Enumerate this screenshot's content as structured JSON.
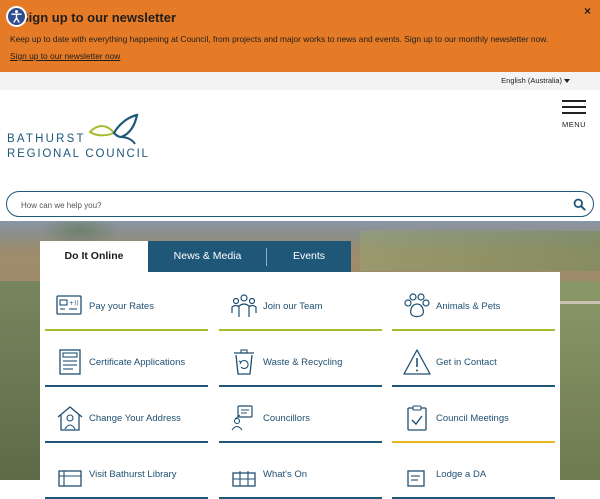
{
  "banner": {
    "title": "Sign up to our newsletter",
    "text": "Keep up to date with everything happening at Council, from projects and major works to news and events. Sign up to our monthly newsletter now.",
    "link": "Sign up to our newsletter now",
    "close": "×",
    "color": "#e57b26"
  },
  "language": {
    "selected": "English (Australia)"
  },
  "header": {
    "logo_line1": "BATHURST",
    "logo_line2": "REGIONAL COUNCIL",
    "menu_label": "MENU",
    "brand_color": "#1f5779",
    "accent_color": "#a7bb2f"
  },
  "search": {
    "placeholder": "How can we help you?"
  },
  "tabs": [
    {
      "label": "Do It Online",
      "active": true
    },
    {
      "label": "News & Media",
      "active": false
    },
    {
      "label": "Events",
      "active": false
    }
  ],
  "items": [
    {
      "label": "Pay your Rates",
      "icon": "rates-card-icon",
      "accent": "#a7bb2f"
    },
    {
      "label": "Join our Team",
      "icon": "team-icon",
      "accent": "#a7bb2f"
    },
    {
      "label": "Animals & Pets",
      "icon": "paw-icon",
      "accent": "#a7bb2f"
    },
    {
      "label": "Certificate Applications",
      "icon": "certificate-icon",
      "accent": "#1f5779"
    },
    {
      "label": "Waste & Recycling",
      "icon": "recycle-bin-icon",
      "accent": "#1f5779"
    },
    {
      "label": "Get in Contact",
      "icon": "alert-triangle-icon",
      "accent": "#1f5779"
    },
    {
      "label": "Change Your Address",
      "icon": "house-person-icon",
      "accent": "#1f5779"
    },
    {
      "label": "Councillors",
      "icon": "councillors-icon",
      "accent": "#1f5779"
    },
    {
      "label": "Council Meetings",
      "icon": "clipboard-check-icon",
      "accent": "#e8b91e"
    },
    {
      "label": "Visit Bathurst Library",
      "icon": "library-icon",
      "accent": "#1f5779"
    },
    {
      "label": "What's On",
      "icon": "calendar-icon",
      "accent": "#1f5779"
    },
    {
      "label": "Lodge a DA",
      "icon": "document-edit-icon",
      "accent": "#1f5779"
    }
  ]
}
